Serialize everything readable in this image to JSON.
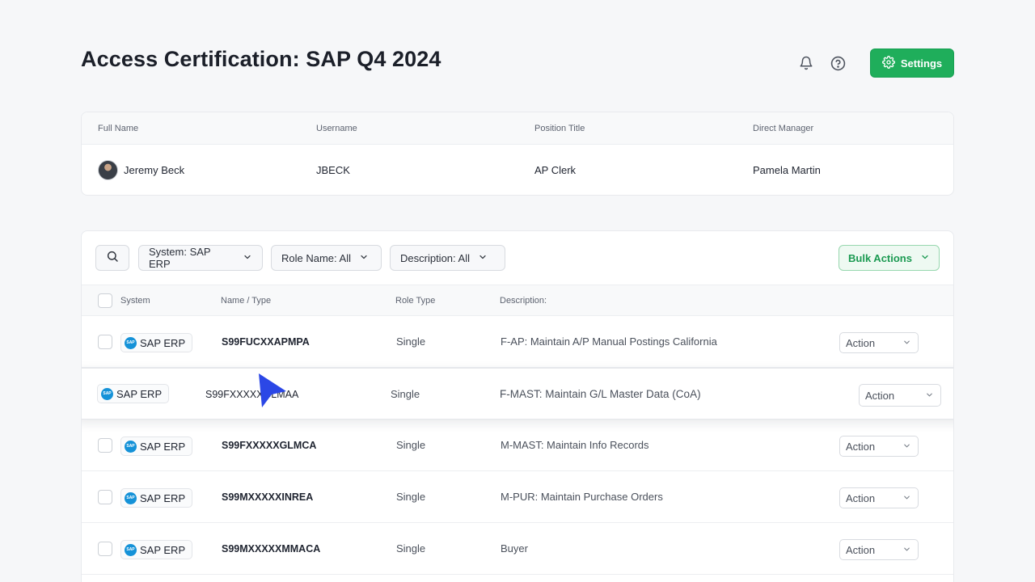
{
  "page": {
    "title": "Access Certification: SAP Q4 2024"
  },
  "header": {
    "bell_icon": "bell-icon",
    "help_icon": "help-circle-icon",
    "settings_label": "Settings",
    "accent": "#1fae5b"
  },
  "user": {
    "columns": [
      "Full Name",
      "Username",
      "Position Title",
      "Direct Manager"
    ],
    "full_name": "Jeremy Beck",
    "username": "JBECK",
    "position_title": "AP Clerk",
    "direct_manager": "Pamela Martin"
  },
  "toolbar": {
    "filters": [
      "System: SAP ERP",
      "Role Name: All",
      "Description: All"
    ],
    "bulk_actions_label": "Bulk Actions"
  },
  "table": {
    "columns": [
      "System",
      "Name / Type",
      "Role Type",
      "Description:"
    ],
    "rows": [
      {
        "system": "SAP ERP",
        "name": "S99FUCXXAPMPA",
        "role_type": "Single",
        "description": "F-AP: Maintain A/P Manual Postings California",
        "action": "Action"
      },
      {
        "system": "SAP ERP",
        "name": "S99FXXXXXGLMAA",
        "role_type": "Single",
        "description": "F-MAST: Maintain G/L Master Data (CoA)",
        "action": "Action"
      },
      {
        "system": "SAP ERP",
        "name": "S99FXXXXXGLMCA",
        "role_type": "Single",
        "description": "M-MAST: Maintain Info Records",
        "action": "Action"
      },
      {
        "system": "SAP ERP",
        "name": "S99MXXXXXINREA",
        "role_type": "Single",
        "description": "M-PUR: Maintain Purchase Orders",
        "action": "Action"
      },
      {
        "system": "SAP ERP",
        "name": "S99MXXXXXMMACA",
        "role_type": "Single",
        "description": "Buyer",
        "action": "Action"
      }
    ]
  }
}
